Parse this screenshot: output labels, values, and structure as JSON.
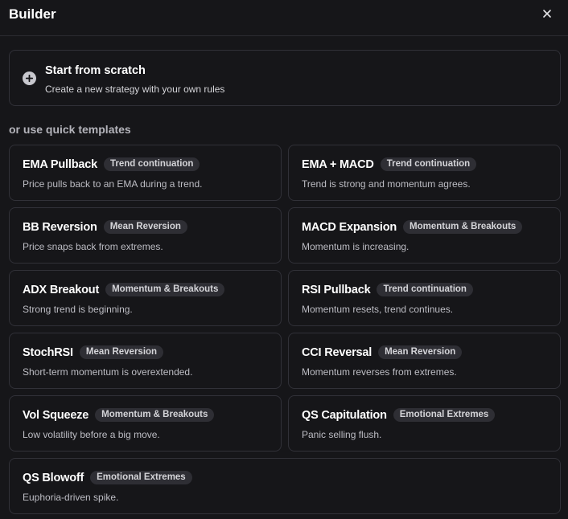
{
  "header": {
    "title": "Builder",
    "close_icon": "close-icon"
  },
  "scratch": {
    "icon": "plus-circle-icon",
    "title": "Start from scratch",
    "description": "Create a new strategy with your own rules"
  },
  "section_label": "or use quick templates",
  "templates": [
    {
      "name": "EMA Pullback",
      "tag": "Trend continuation",
      "description": "Price pulls back to an EMA during a trend."
    },
    {
      "name": "EMA + MACD",
      "tag": "Trend continuation",
      "description": "Trend is strong and momentum agrees."
    },
    {
      "name": "BB Reversion",
      "tag": "Mean Reversion",
      "description": "Price snaps back from extremes."
    },
    {
      "name": "MACD Expansion",
      "tag": "Momentum & Breakouts",
      "description": "Momentum is increasing."
    },
    {
      "name": "ADX Breakout",
      "tag": "Momentum & Breakouts",
      "description": "Strong trend is beginning."
    },
    {
      "name": "RSI Pullback",
      "tag": "Trend continuation",
      "description": "Momentum resets, trend continues."
    },
    {
      "name": "StochRSI",
      "tag": "Mean Reversion",
      "description": "Short-term momentum is overextended."
    },
    {
      "name": "CCI Reversal",
      "tag": "Mean Reversion",
      "description": "Momentum reverses from extremes."
    },
    {
      "name": "Vol Squeeze",
      "tag": "Momentum & Breakouts",
      "description": "Low volatility before a big move."
    },
    {
      "name": "QS Capitulation",
      "tag": "Emotional Extremes",
      "description": "Panic selling flush."
    },
    {
      "name": "QS Blowoff",
      "tag": "Emotional Extremes",
      "description": "Euphoria-driven spike."
    }
  ],
  "colors": {
    "background": "#161619",
    "border": "#313138",
    "badge_bg": "#2e2e34",
    "muted_text": "#bdbdc4"
  }
}
